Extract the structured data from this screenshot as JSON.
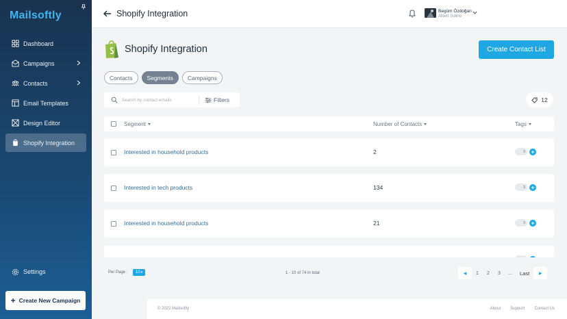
{
  "app": {
    "logo": "Mailsoftly",
    "colors": {
      "accent": "#1fa7e3",
      "sidebar_top": "#19334f",
      "sidebar_bottom": "#1d5e95",
      "link": "#2f6e9e"
    }
  },
  "sidebar": {
    "items": [
      {
        "label": "Dashboard",
        "icon": "dashboard-icon"
      },
      {
        "label": "Campaigns",
        "icon": "campaigns-icon",
        "expandable": true
      },
      {
        "label": "Contacts",
        "icon": "contacts-icon",
        "expandable": true
      },
      {
        "label": "Email Templates",
        "icon": "templates-icon"
      },
      {
        "label": "Design Editor",
        "icon": "design-editor-icon"
      },
      {
        "label": "Shopify Integration",
        "icon": "shopify-icon",
        "active": true
      }
    ],
    "settings_label": "Settings",
    "create_campaign_label": "Create New Campaign"
  },
  "topbar": {
    "title": "Shopify Integration",
    "user_name": "Begüm Özdoğan",
    "user_subtitle": "Albert Solino"
  },
  "header": {
    "title": "Shopify Integration",
    "cta_label": "Create Contact List"
  },
  "tabs": [
    {
      "label": "Contacts",
      "active": false
    },
    {
      "label": "Segments",
      "active": true
    },
    {
      "label": "Campaigns",
      "active": false
    }
  ],
  "search": {
    "placeholder": "Search by contact emails",
    "filters_label": "Filters",
    "tag_count": "12"
  },
  "table": {
    "columns": [
      "Segment",
      "Number of Contacts",
      "Tags"
    ],
    "rows": [
      {
        "segment": "Interested in household products",
        "contacts": "2",
        "tags": "3"
      },
      {
        "segment": "Interested in tech products",
        "contacts": "134",
        "tags": "3"
      },
      {
        "segment": "Interested in household products",
        "contacts": "21",
        "tags": "3"
      }
    ]
  },
  "pagination": {
    "per_page_label": "Per Page :",
    "per_page_value": "10",
    "range_text": "1 - 10 of 74 in total",
    "pages": [
      "1",
      "2",
      "3",
      "..."
    ],
    "last_label": "Last"
  },
  "footer": {
    "copyright": "© 2022 Mailsoftly",
    "links": [
      "About",
      "Support",
      "Contact Us"
    ]
  }
}
